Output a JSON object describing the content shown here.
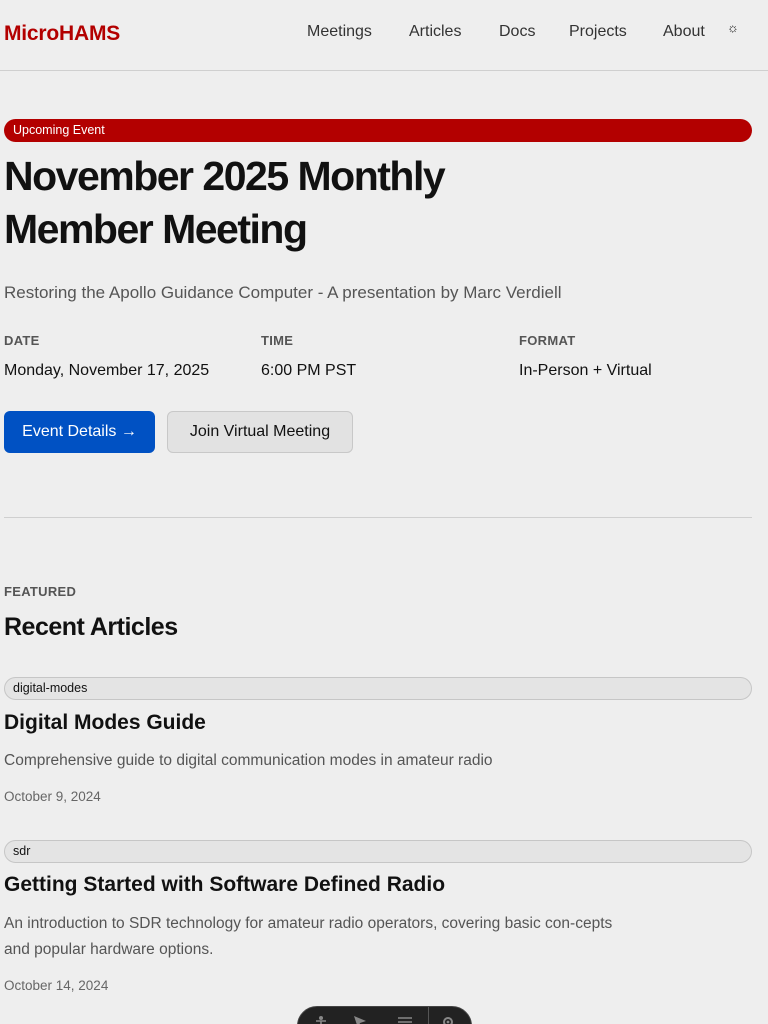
{
  "header": {
    "logo": "MicroHAMS",
    "nav": [
      "Meetings",
      "Articles",
      "Docs",
      "Projects",
      "About"
    ],
    "theme_icon": "☼"
  },
  "event": {
    "badge": "Upcoming Event",
    "title": "November 2025 Monthly Member Meeting",
    "subtitle": "Restoring the Apollo Guidance Computer - A presentation by Marc Verdiell",
    "date_label": "DATE",
    "date": "Monday, November 17, 2025",
    "time_label": "TIME",
    "time": "6:00 PM PST",
    "format_label": "FORMAT",
    "format": "In-Person + Virtual",
    "details_button": "Event Details →",
    "join_button": "Join Virtual Meeting"
  },
  "articles": {
    "eyebrow": "FEATURED",
    "heading": "Recent Articles",
    "items": [
      {
        "tag": "digital-modes",
        "title": "Digital Modes Guide",
        "description": "Comprehensive guide to digital communication modes in amateur radio",
        "date": "October 9, 2024"
      },
      {
        "tag": "sdr",
        "title": "Getting Started with Software Defined Radio",
        "description": "An introduction to SDR technology for amateur radio operators, covering basic con-cepts and popular hardware options.",
        "date": "October 14, 2024"
      }
    ]
  },
  "colors": {
    "brand": "#b30000",
    "primary_button": "#0051c3",
    "background": "#eeeeee"
  },
  "icons": {
    "theme_toggle": "sun-icon",
    "toolbar": [
      "accessibility-icon",
      "cursor-icon",
      "menu-icon",
      "settings-icon"
    ]
  }
}
